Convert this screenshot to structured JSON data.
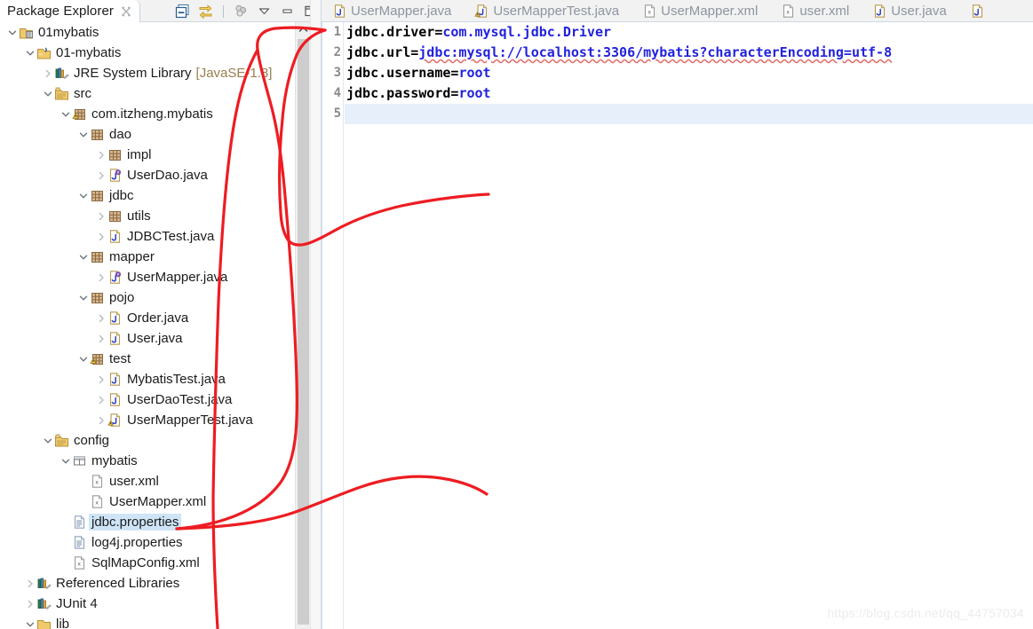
{
  "explorer": {
    "tab_title": "Package Explorer",
    "close_icon": "close-icon",
    "toolbar": [
      {
        "name": "collapse-all-icon",
        "label": "Collapse All"
      },
      {
        "name": "link-with-editor-icon",
        "label": "Link with Editor"
      },
      {
        "name": "view-menu-icon",
        "label": "View Menu"
      },
      {
        "name": "chevron-down-icon",
        "label": "Menu"
      },
      {
        "name": "minimize-icon",
        "label": "Minimize"
      },
      {
        "name": "maximize-icon",
        "label": "Maximize"
      }
    ],
    "tree": [
      {
        "label": "01mybatis",
        "suffix": "",
        "depth": 0,
        "twisty": "v",
        "icon": "project-closed-icon",
        "selected": false
      },
      {
        "label": "01-mybatis",
        "suffix": "",
        "depth": 1,
        "twisty": "v",
        "icon": "java-project-icon",
        "selected": false
      },
      {
        "label": "JRE System Library",
        "suffix": "[JavaSE-1.8]",
        "depth": 2,
        "twisty": ">",
        "icon": "library-icon",
        "selected": false
      },
      {
        "label": "src",
        "suffix": "",
        "depth": 2,
        "twisty": "v",
        "icon": "source-folder-icon",
        "selected": false
      },
      {
        "label": "com.itzheng.mybatis",
        "suffix": "",
        "depth": 3,
        "twisty": "v",
        "icon": "package-warning-icon",
        "selected": false
      },
      {
        "label": "dao",
        "suffix": "",
        "depth": 4,
        "twisty": "v",
        "icon": "package-icon",
        "selected": false
      },
      {
        "label": "impl",
        "suffix": "",
        "depth": 5,
        "twisty": ">",
        "icon": "package-icon",
        "selected": false
      },
      {
        "label": "UserDao.java",
        "suffix": "",
        "depth": 5,
        "twisty": ">",
        "icon": "java-interface-icon",
        "selected": false
      },
      {
        "label": "jdbc",
        "suffix": "",
        "depth": 4,
        "twisty": "v",
        "icon": "package-icon",
        "selected": false
      },
      {
        "label": "utils",
        "suffix": "",
        "depth": 5,
        "twisty": ">",
        "icon": "package-icon",
        "selected": false
      },
      {
        "label": "JDBCTest.java",
        "suffix": "",
        "depth": 5,
        "twisty": ">",
        "icon": "java-file-icon",
        "selected": false
      },
      {
        "label": "mapper",
        "suffix": "",
        "depth": 4,
        "twisty": "v",
        "icon": "package-icon",
        "selected": false
      },
      {
        "label": "UserMapper.java",
        "suffix": "",
        "depth": 5,
        "twisty": ">",
        "icon": "java-interface-icon",
        "selected": false
      },
      {
        "label": "pojo",
        "suffix": "",
        "depth": 4,
        "twisty": "v",
        "icon": "package-icon",
        "selected": false
      },
      {
        "label": "Order.java",
        "suffix": "",
        "depth": 5,
        "twisty": ">",
        "icon": "java-file-icon",
        "selected": false
      },
      {
        "label": "User.java",
        "suffix": "",
        "depth": 5,
        "twisty": ">",
        "icon": "java-file-icon",
        "selected": false
      },
      {
        "label": "test",
        "suffix": "",
        "depth": 4,
        "twisty": "v",
        "icon": "package-warning-icon",
        "selected": false
      },
      {
        "label": "MybatisTest.java",
        "suffix": "",
        "depth": 5,
        "twisty": ">",
        "icon": "java-file-icon",
        "selected": false
      },
      {
        "label": "UserDaoTest.java",
        "suffix": "",
        "depth": 5,
        "twisty": ">",
        "icon": "java-file-icon",
        "selected": false
      },
      {
        "label": "UserMapperTest.java",
        "suffix": "",
        "depth": 5,
        "twisty": ">",
        "icon": "java-file-warning-icon",
        "selected": false
      },
      {
        "label": "config",
        "suffix": "",
        "depth": 2,
        "twisty": "v",
        "icon": "source-folder-icon",
        "selected": false
      },
      {
        "label": "mybatis",
        "suffix": "",
        "depth": 3,
        "twisty": "v",
        "icon": "folder-package-icon",
        "selected": false
      },
      {
        "label": "user.xml",
        "suffix": "",
        "depth": 4,
        "twisty": "",
        "icon": "xml-file-icon",
        "selected": false
      },
      {
        "label": "UserMapper.xml",
        "suffix": "",
        "depth": 4,
        "twisty": "",
        "icon": "xml-file-icon",
        "selected": false
      },
      {
        "label": "jdbc.properties",
        "suffix": "",
        "depth": 3,
        "twisty": "",
        "icon": "properties-file-icon",
        "selected": true
      },
      {
        "label": "log4j.properties",
        "suffix": "",
        "depth": 3,
        "twisty": "",
        "icon": "properties-file-icon",
        "selected": false
      },
      {
        "label": "SqlMapConfig.xml",
        "suffix": "",
        "depth": 3,
        "twisty": "",
        "icon": "xml-file-icon",
        "selected": false
      },
      {
        "label": "Referenced Libraries",
        "suffix": "",
        "depth": 1,
        "twisty": ">",
        "icon": "library-icon",
        "selected": false
      },
      {
        "label": "JUnit 4",
        "suffix": "",
        "depth": 1,
        "twisty": ">",
        "icon": "library-icon",
        "selected": false
      },
      {
        "label": "lib",
        "suffix": "",
        "depth": 1,
        "twisty": "v",
        "icon": "folder-icon",
        "selected": false
      }
    ],
    "scrollbar": {
      "up_arrow": "chevron-up-icon"
    }
  },
  "editor": {
    "tabs": [
      {
        "label": "UserMapper.java",
        "icon": "java-file-icon",
        "active": false
      },
      {
        "label": "UserMapperTest.java",
        "icon": "java-file-warning-icon",
        "active": false
      },
      {
        "label": "UserMapper.xml",
        "icon": "xml-file-icon",
        "active": false
      },
      {
        "label": "user.xml",
        "icon": "xml-file-icon",
        "active": false
      },
      {
        "label": "User.java",
        "icon": "java-file-icon",
        "active": false
      },
      {
        "label": "",
        "icon": "java-file-icon",
        "active": false
      }
    ],
    "line_numbers": [
      "1",
      "2",
      "3",
      "4",
      "5"
    ],
    "lines": [
      {
        "key": "jdbc.driver=",
        "value": "com.mysql.jdbc.Driver",
        "underline": false,
        "current": false
      },
      {
        "key": "jdbc.url=",
        "value": "jdbc:mysql://localhost:3306/mybatis?characterEncoding=utf-8",
        "underline": true,
        "current": false
      },
      {
        "key": "jdbc.username=",
        "value": "root",
        "underline": false,
        "current": false
      },
      {
        "key": "jdbc.password=",
        "value": "root",
        "underline": false,
        "current": false
      },
      {
        "key": "",
        "value": "",
        "underline": false,
        "current": true
      }
    ]
  },
  "annotation": {
    "name": "red-handdrawn-pointer",
    "color": "#ee1c22",
    "description": "Hand-drawn red loop from jdbc.properties in the tree up around the editor's first lines"
  },
  "watermark": {
    "text": "https://blog.csdn.net/qq_44757034",
    "color": "#ececec"
  },
  "colors": {
    "selection": "#cfe5f7",
    "current_line": "#e6effa",
    "code_key": "#000000",
    "code_value": "#2222dd",
    "annotation_red": "#ee1c22",
    "tab_text": "#8d95a0",
    "tree_text": "#1b1b1b",
    "suffix_text": "#9a7f4f"
  }
}
